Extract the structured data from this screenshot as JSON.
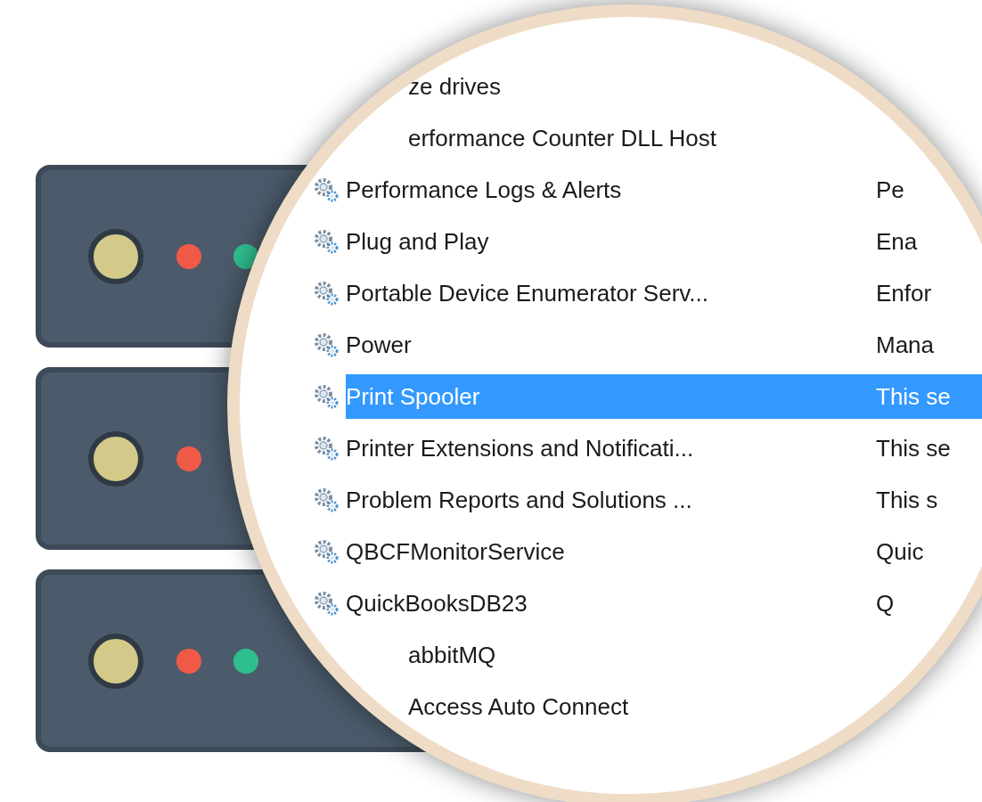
{
  "services": {
    "rows": [
      {
        "name": "ze drives",
        "description": "",
        "icon": false,
        "selected": false
      },
      {
        "name": "erformance Counter DLL Host",
        "description": "",
        "icon": false,
        "selected": false
      },
      {
        "name": "Performance Logs & Alerts",
        "description": "Pe",
        "icon": true,
        "selected": false
      },
      {
        "name": "Plug and Play",
        "description": "Ena",
        "icon": true,
        "selected": false
      },
      {
        "name": "Portable Device Enumerator Serv...",
        "description": "Enfor",
        "icon": true,
        "selected": false
      },
      {
        "name": "Power",
        "description": "Mana",
        "icon": true,
        "selected": false
      },
      {
        "name": "Print Spooler",
        "description": "This se",
        "icon": true,
        "selected": true
      },
      {
        "name": "Printer Extensions and Notificati...",
        "description": "This se",
        "icon": true,
        "selected": false
      },
      {
        "name": "Problem Reports and Solutions ...",
        "description": "This s",
        "icon": true,
        "selected": false
      },
      {
        "name": "QBCFMonitorService",
        "description": "Quic",
        "icon": true,
        "selected": false
      },
      {
        "name": "QuickBooksDB23",
        "description": "Q",
        "icon": true,
        "selected": false
      },
      {
        "name": "abbitMQ",
        "description": "",
        "icon": false,
        "selected": false
      },
      {
        "name": "Access Auto Connect",
        "description": "",
        "icon": false,
        "selected": false
      }
    ]
  }
}
